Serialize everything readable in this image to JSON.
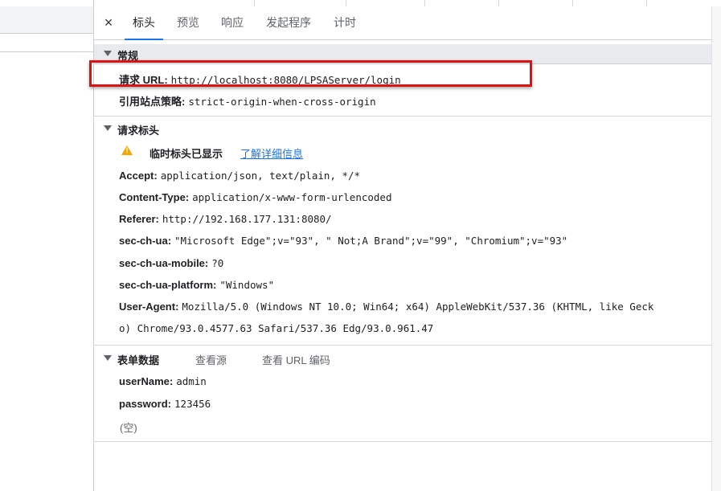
{
  "tabs": [
    {
      "label": "标头",
      "active": true
    },
    {
      "label": "预览",
      "active": false
    },
    {
      "label": "响应",
      "active": false
    },
    {
      "label": "发起程序",
      "active": false
    },
    {
      "label": "计时",
      "active": false
    }
  ],
  "close_icon": "×",
  "general": {
    "title": "常规",
    "request_url_key": "请求 URL:",
    "request_url_value": "http://localhost:8080/LPSAServer/login",
    "referrer_policy_key": "引用站点策略:",
    "referrer_policy_value": "strict-origin-when-cross-origin"
  },
  "request_headers": {
    "title": "请求标头",
    "warning_text": "临时标头已显示",
    "learn_more": "了解详细信息",
    "items": [
      {
        "key": "Accept:",
        "value": "application/json, text/plain, */*"
      },
      {
        "key": "Content-Type:",
        "value": "application/x-www-form-urlencoded"
      },
      {
        "key": "Referer:",
        "value": "http://192.168.177.131:8080/"
      },
      {
        "key": "sec-ch-ua:",
        "value": "\"Microsoft Edge\";v=\"93\", \" Not;A Brand\";v=\"99\", \"Chromium\";v=\"93\""
      },
      {
        "key": "sec-ch-ua-mobile:",
        "value": "?0"
      },
      {
        "key": "sec-ch-ua-platform:",
        "value": "\"Windows\""
      },
      {
        "key": "User-Agent:",
        "value": "Mozilla/5.0 (Windows NT 10.0; Win64; x64) AppleWebKit/537.36 (KHTML, like Geck"
      }
    ],
    "user_agent_cont": "o) Chrome/93.0.4577.63 Safari/537.36 Edg/93.0.961.47"
  },
  "form_data": {
    "title": "表单数据",
    "view_source": "查看源",
    "view_url_encoded": "查看 URL 编码",
    "items": [
      {
        "key": "userName:",
        "value": "admin"
      },
      {
        "key": "password:",
        "value": "123456"
      }
    ],
    "empty": "(空)"
  },
  "colors": {
    "accent": "#1a73e8",
    "highlight": "#e01010",
    "warning": "#f2a600"
  }
}
